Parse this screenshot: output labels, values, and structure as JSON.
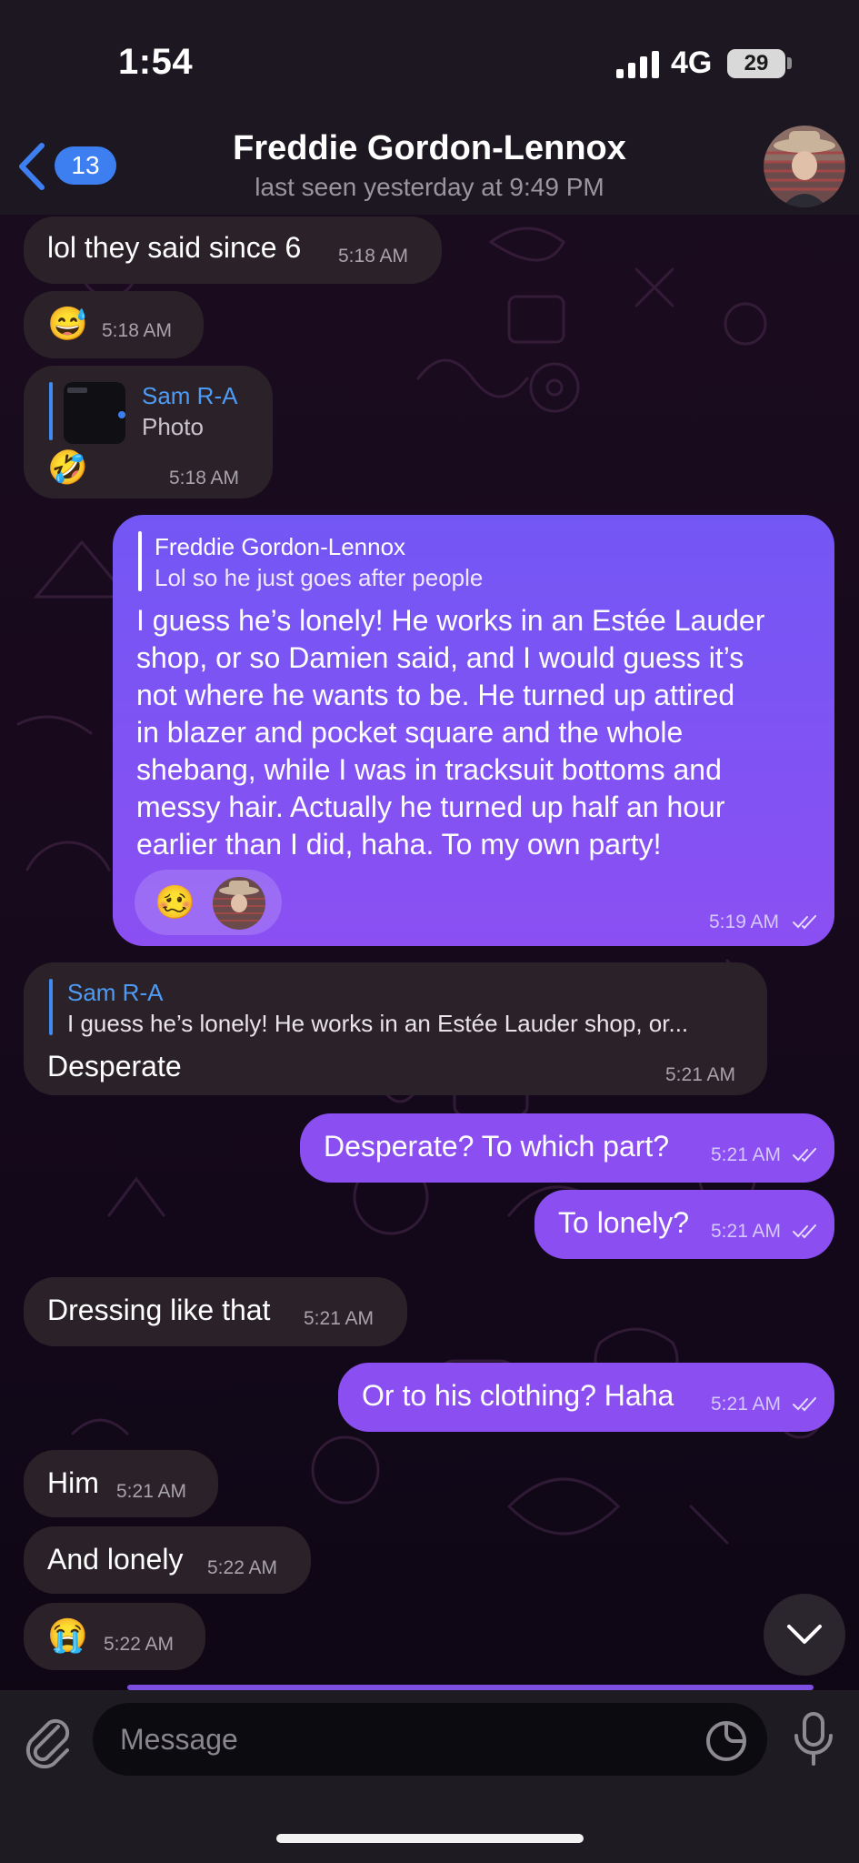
{
  "status_bar": {
    "time": "1:54",
    "network": "4G",
    "battery": "29"
  },
  "header": {
    "back_count": "13",
    "contact_name": "Freddie Gordon-Lennox",
    "last_seen": "last seen yesterday at 9:49 PM"
  },
  "messages": [
    {
      "dir": "in",
      "text": "lol they said since 6",
      "time": "5:18 AM"
    },
    {
      "dir": "in",
      "emoji": "😅",
      "time": "5:18 AM"
    },
    {
      "dir": "in",
      "reply_name": "Sam R-A",
      "reply_text": "Photo",
      "emoji": "🤣",
      "time": "5:18 AM"
    },
    {
      "dir": "out",
      "reply_name": "Freddie Gordon-Lennox",
      "reply_text": "Lol so he just goes after people",
      "lines": [
        "I guess he’s lonely! He works in an Estée Lauder",
        "shop, or so Damien said, and I would guess it’s",
        "not where he wants to be. He turned up attired",
        "in blazer and pocket square and the whole",
        "shebang, while I was in tracksuit bottoms and",
        "messy hair. Actually he turned up half an hour",
        "earlier than I did, haha. To my own party!"
      ],
      "reaction_emoji": "🥴",
      "time": "5:19 AM"
    },
    {
      "dir": "in",
      "reply_name": "Sam R-A",
      "reply_text": "I guess he’s lonely! He works in an Estée Lauder shop, or...",
      "text": "Desperate",
      "time": "5:21 AM"
    },
    {
      "dir": "out",
      "text": "Desperate? To which part?",
      "time": "5:21 AM"
    },
    {
      "dir": "out",
      "text": "To lonely?",
      "time": "5:21 AM"
    },
    {
      "dir": "in",
      "text": "Dressing like that",
      "time": "5:21 AM"
    },
    {
      "dir": "out",
      "text": "Or to his clothing? Haha",
      "time": "5:21 AM"
    },
    {
      "dir": "in",
      "text": "Him",
      "time": "5:21 AM"
    },
    {
      "dir": "in",
      "text": "And lonely",
      "time": "5:22 AM"
    },
    {
      "dir": "in",
      "emoji": "😭",
      "time": "5:22 AM"
    }
  ],
  "composer": {
    "placeholder": "Message"
  },
  "colors": {
    "accent": "#3d7ff0",
    "outgoing": "#7c52f3",
    "incoming": "#2a2228"
  }
}
